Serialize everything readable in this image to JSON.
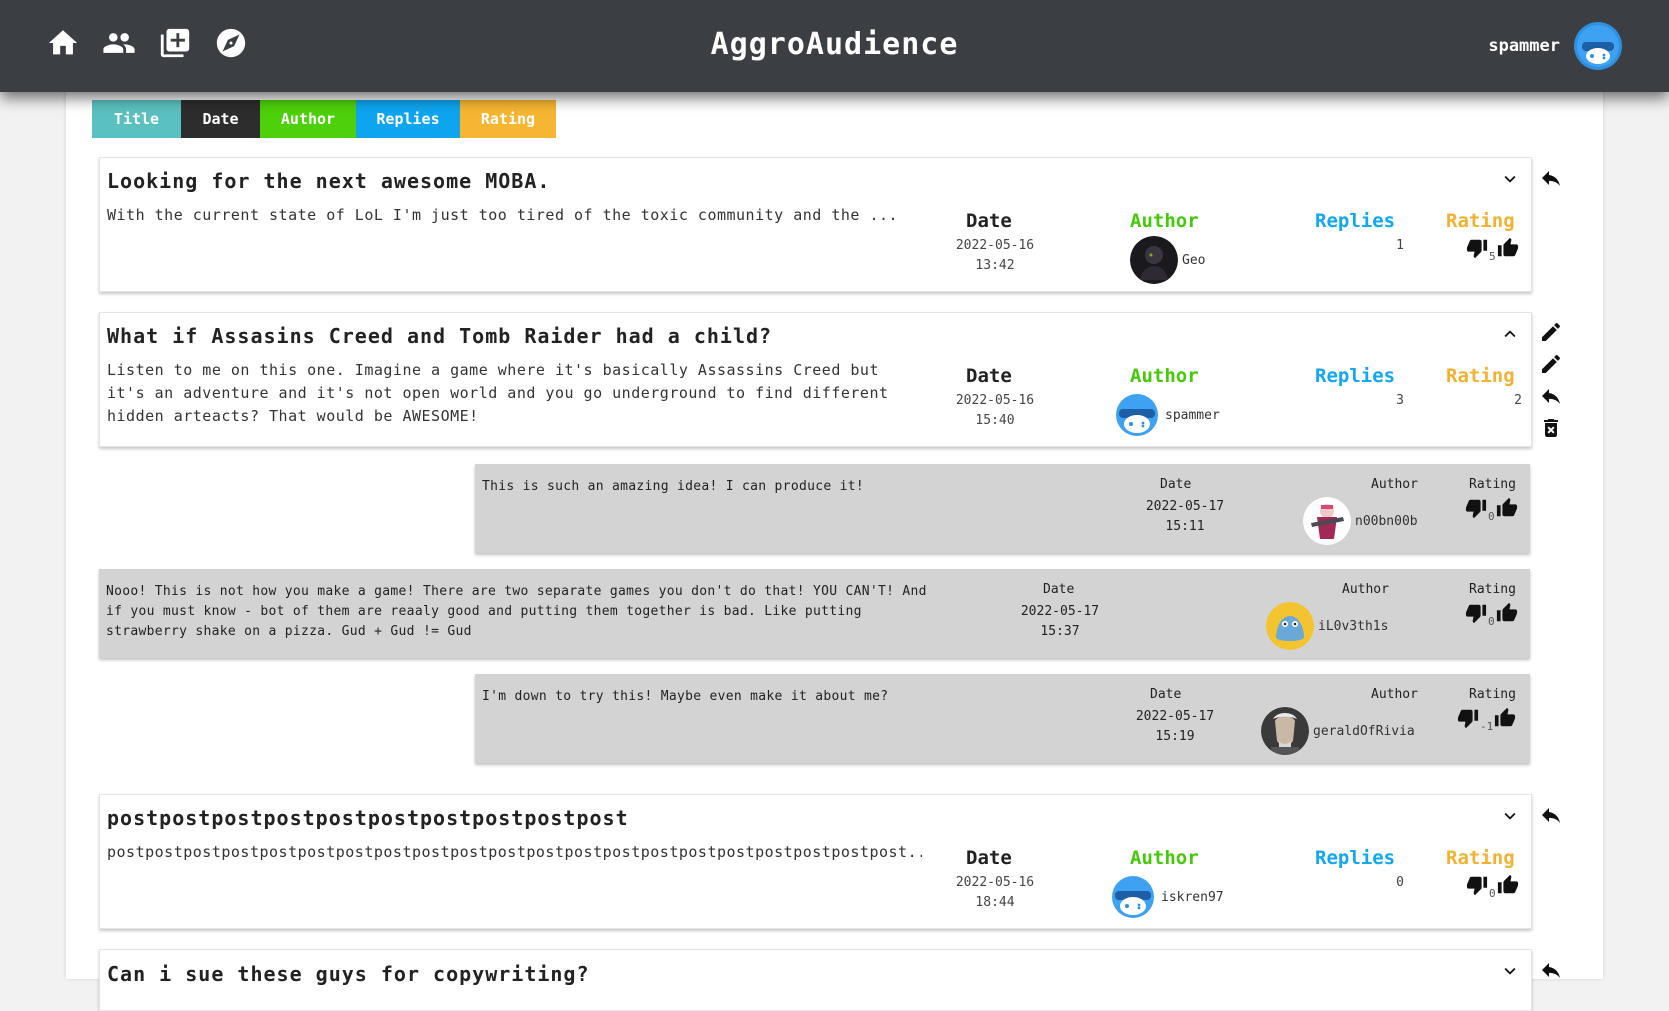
{
  "header": {
    "brand": "AggroAudience",
    "username": "spammer",
    "nav": [
      {
        "icon": "home-icon"
      },
      {
        "icon": "people-icon"
      },
      {
        "icon": "add-post-icon"
      },
      {
        "icon": "compass-icon"
      }
    ]
  },
  "sort_tabs": {
    "title": "Title",
    "date": "Date",
    "author": "Author",
    "replies": "Replies",
    "rating": "Rating"
  },
  "labels": {
    "date": "Date",
    "author": "Author",
    "replies": "Replies",
    "rating": "Rating"
  },
  "posts": [
    {
      "title": "Looking for the next awesome MOBA.",
      "snippet": "With the current state of LoL I'm just too tired of the toxic community and the ...",
      "date": "2022-05-16",
      "time": "13:42",
      "author": "Geo",
      "replies": "1",
      "rating": "5"
    },
    {
      "title": "What if Assasins Creed and Tomb Raider had a child?",
      "snippet": "Listen to me on this one. Imagine a game where it's basically Assassins Creed but it's an adventure and it's not open world and you go underground to find different hidden arteacts? That would be AWESOME!",
      "date": "2022-05-16",
      "time": "15:40",
      "author": "spammer",
      "replies": "3",
      "rating": "2"
    },
    {
      "title": "postpostpostpostpostpostpostpostpostpost",
      "snippet": "postpostpostpostpostpostpostpostpostpostpostpostpostpostpostpostpostpostpostpostpost...",
      "date": "2022-05-16",
      "time": "18:44",
      "author": "iskren97",
      "replies": "0",
      "rating": "0"
    },
    {
      "title": "Can i sue these guys for copywriting?"
    }
  ],
  "replies": [
    {
      "text": "This is such an amazing idea! I can produce it!",
      "date": "2022-05-17",
      "time": "15:11",
      "author": "n00bn00b",
      "rating": "0"
    },
    {
      "text": "Nooo! This is not how you make a game! There are two separate games you don't do that! YOU CAN'T! And if you must know - bot of them are reaaly good and putting them together is bad. Like putting strawberry shake on a pizza. Gud + Gud != Gud",
      "date": "2022-05-17",
      "time": "15:37",
      "author": "iL0v3th1s",
      "rating": "0"
    },
    {
      "text": "I'm down to try this! Maybe even make it about me?",
      "date": "2022-05-17",
      "time": "15:19",
      "author": "geraldOfRivia",
      "rating": "-1"
    }
  ],
  "colors": {
    "topbar": "#3b3e43",
    "title_tab": "#5bc0c0",
    "date_tab": "#2d2d2d",
    "author_tab": "#4cd10a",
    "replies_tab": "#0ea5f0",
    "rating_tab": "#f6b631",
    "reply_bg": "#d3d3d3"
  }
}
